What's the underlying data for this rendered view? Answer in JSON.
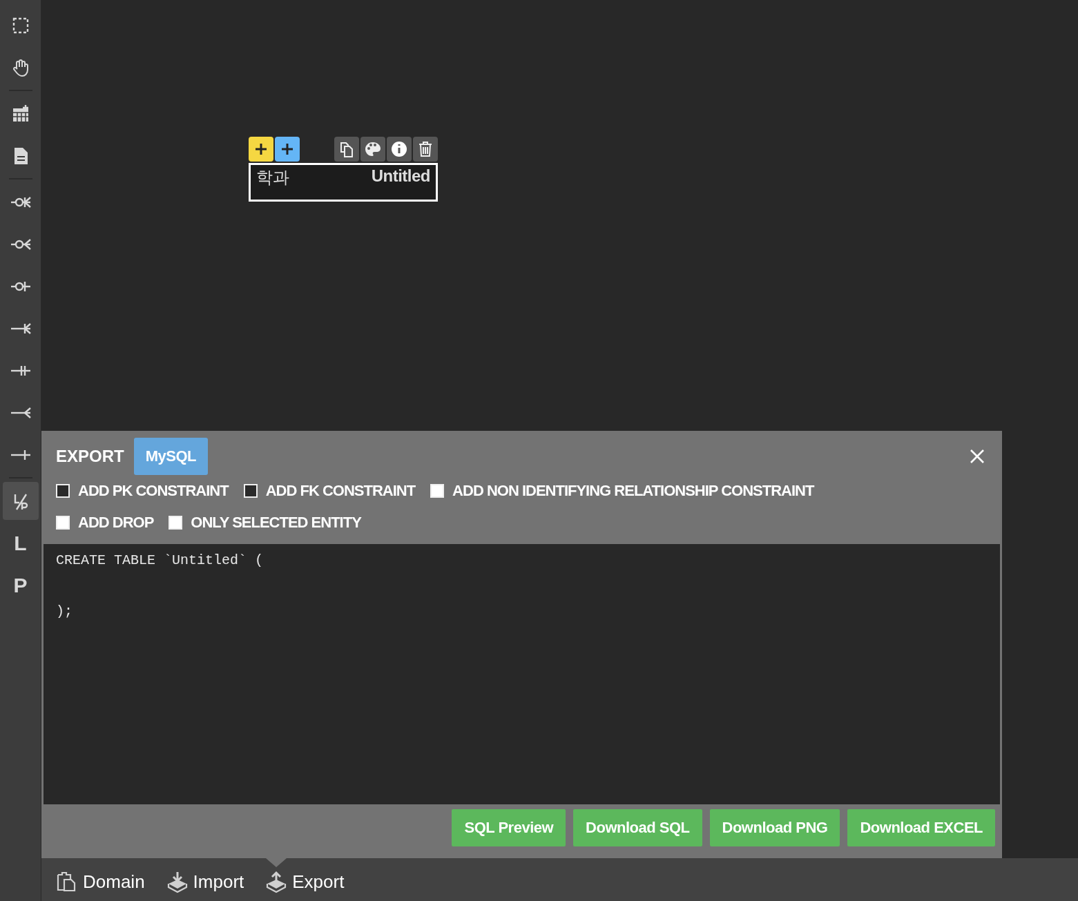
{
  "sidebar": {
    "groups": [
      [
        {
          "kind": "select",
          "selected": false
        },
        {
          "kind": "hand",
          "selected": false
        }
      ],
      [
        {
          "kind": "table",
          "selected": false
        },
        {
          "kind": "memo",
          "selected": false
        }
      ],
      [
        {
          "kind": "zero-one-many",
          "selected": false
        },
        {
          "kind": "zero-many",
          "selected": false
        },
        {
          "kind": "zero-one",
          "selected": false
        },
        {
          "kind": "one-many",
          "selected": false
        },
        {
          "kind": "one-only",
          "selected": false
        },
        {
          "kind": "many",
          "selected": false
        },
        {
          "kind": "one",
          "selected": false
        }
      ],
      [
        {
          "kind": "identify-toggle",
          "selected": true
        },
        {
          "kind": "letter",
          "label": "L",
          "selected": false
        },
        {
          "kind": "letter",
          "label": "P",
          "selected": false
        }
      ]
    ]
  },
  "entity": {
    "name": "학과",
    "comment": "Untitled",
    "add_buttons": [
      {
        "color": "#f5d742"
      },
      {
        "color": "#64b5f6"
      }
    ],
    "tools": [
      {
        "kind": "copy"
      },
      {
        "kind": "palette"
      },
      {
        "kind": "info"
      },
      {
        "kind": "trash"
      }
    ]
  },
  "export_panel": {
    "title": "EXPORT",
    "database": "MySQL",
    "options": [
      [
        {
          "label": "ADD PK CONSTRAINT",
          "checked": true
        },
        {
          "label": "ADD FK CONSTRAINT",
          "checked": true
        },
        {
          "label": "ADD NON IDENTIFYING RELATIONSHIP CONSTRAINT",
          "checked": false
        }
      ],
      [
        {
          "label": "ADD DROP",
          "checked": false
        },
        {
          "label": "ONLY SELECTED ENTITY",
          "checked": false
        }
      ]
    ],
    "code": "CREATE TABLE `Untitled` (\n\n\n);",
    "buttons": [
      "SQL Preview",
      "Download SQL",
      "Download PNG",
      "Download EXCEL"
    ]
  },
  "bottom_tabs": [
    {
      "label": "Domain",
      "kind": "domain",
      "selected": false
    },
    {
      "label": "Import",
      "kind": "import",
      "selected": false
    },
    {
      "label": "Export",
      "kind": "export",
      "selected": true
    }
  ]
}
